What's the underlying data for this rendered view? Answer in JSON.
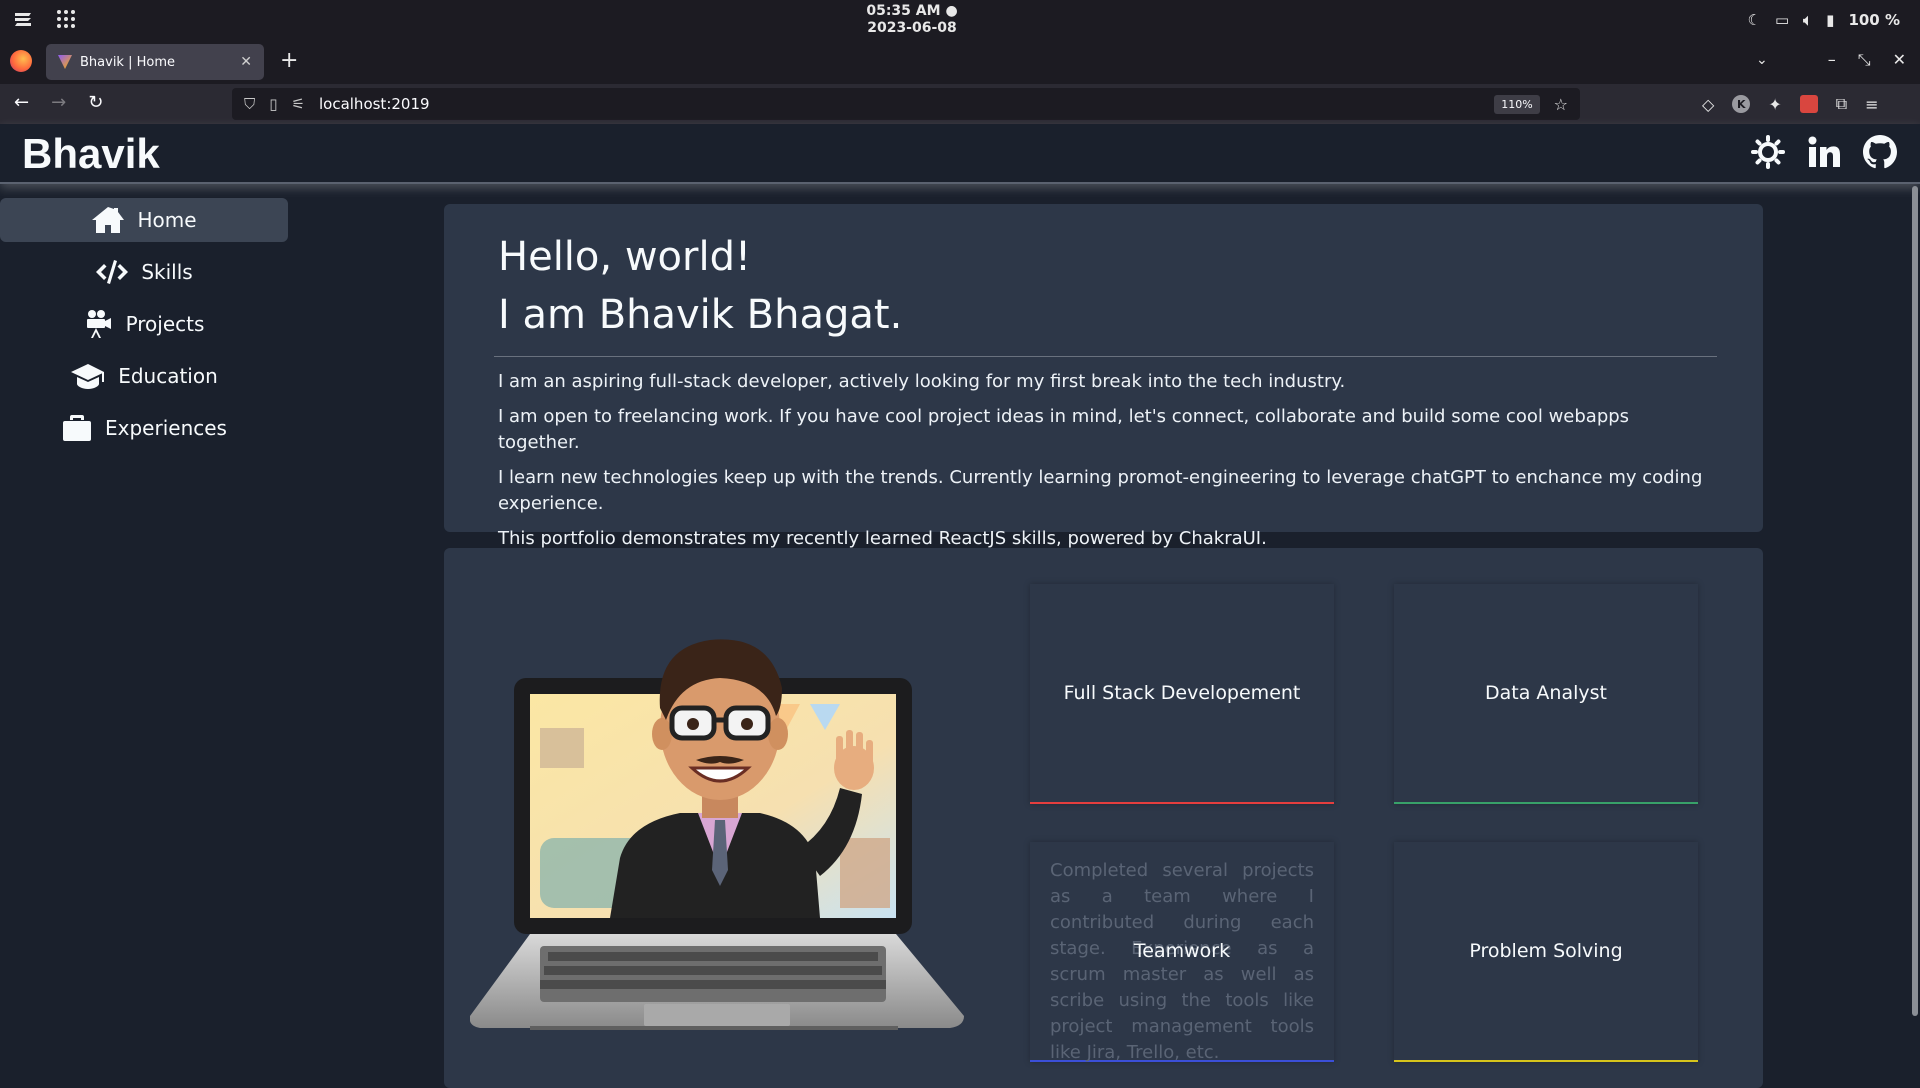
{
  "os": {
    "time": "05:35 AM",
    "date": "2023-06-08",
    "battery": "100 %"
  },
  "browser": {
    "tab_title": "Bhavik | Home",
    "url": "localhost:2019",
    "zoom": "110%"
  },
  "site": {
    "brand": "Bhavik",
    "nav": [
      {
        "label": "Home",
        "icon": "home-icon",
        "active": true
      },
      {
        "label": "Skills",
        "icon": "code-icon",
        "active": false
      },
      {
        "label": "Projects",
        "icon": "video-camera-icon",
        "active": false
      },
      {
        "label": "Education",
        "icon": "graduation-cap-icon",
        "active": false
      },
      {
        "label": "Experiences",
        "icon": "briefcase-icon",
        "active": false
      }
    ],
    "header_icons": [
      "sun-icon",
      "linkedin-icon",
      "github-icon"
    ]
  },
  "intro": {
    "line1": "Hello, world!",
    "line2": "I am Bhavik Bhagat.",
    "paragraphs": [
      "I am an aspiring full-stack developer, actively looking for my first break into the tech industry.",
      "I am open to freelancing work. If you have cool project ideas in mind, let's connect, collaborate and build some cool webapps together.",
      "I learn new technologies keep up with the trends. Currently learning promot-engineering to leverage chatGPT to enchance my coding experience.",
      "This portfolio demonstrates my recently learned ReactJS skills, powered by ChakraUI."
    ]
  },
  "skills": [
    {
      "title": "Full Stack Developement",
      "accent": "#e53e3e",
      "desc": ""
    },
    {
      "title": "Data Analyst",
      "accent": "#38a169",
      "desc": ""
    },
    {
      "title": "Teamwork",
      "accent": "#3b4fd8",
      "desc": "Completed several projects as a team where I contributed during each stage. Experience as a scrum master as well as scribe using the tools like project management tools like Jira, Trello, etc."
    },
    {
      "title": "Problem Solving",
      "accent": "#d6c41c",
      "desc": ""
    }
  ],
  "colors": {
    "page_bg": "#1a202c",
    "card_bg": "#2d3748",
    "text": "#f7fafc"
  }
}
